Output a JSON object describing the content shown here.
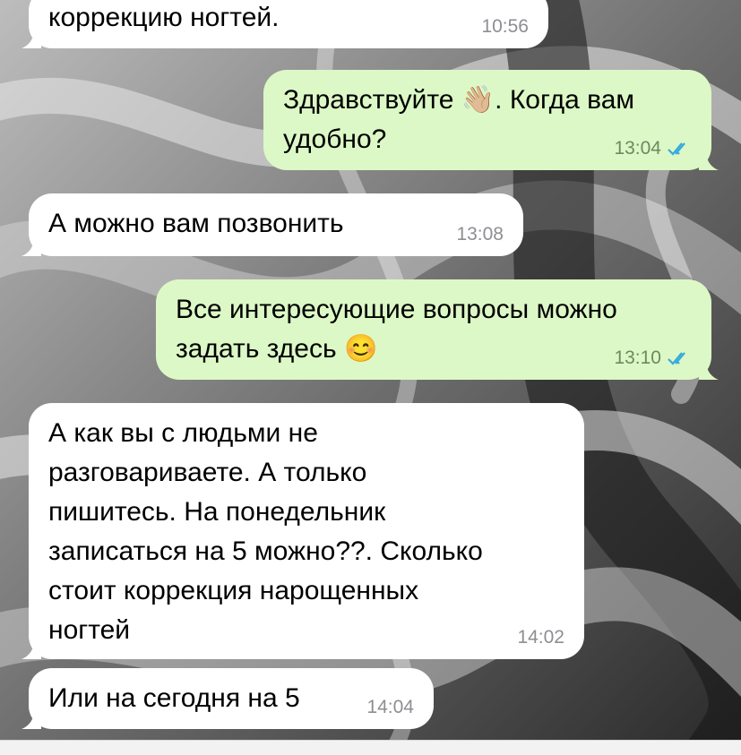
{
  "messages": [
    {
      "dir": "in",
      "text": "коррекцию ногтей.",
      "time": "10:56"
    },
    {
      "dir": "out",
      "text_a": "Здравствуйте ",
      "emoji": "👋🏼",
      "text_b": ". Когда вам\nудобно?",
      "time": "13:04",
      "status": "read"
    },
    {
      "dir": "in",
      "text": "А можно вам позвонить",
      "time": "13:08"
    },
    {
      "dir": "out",
      "text_a": "Все интересующие вопросы можно\nзадать здесь ",
      "emoji": "😊",
      "text_b": "",
      "time": "13:10",
      "status": "read"
    },
    {
      "dir": "in",
      "text": "А как вы с людьми не\nразговариваете. А только\nпишитесь. На понедельник\nзаписаться на 5 можно??. Сколько\nстоит коррекция нарощенных\nногтей",
      "time": "14:02"
    },
    {
      "dir": "in",
      "text": "Или на сегодня на 5",
      "time": "14:04"
    }
  ],
  "colors": {
    "incoming_bubble": "#ffffff",
    "outgoing_bubble": "#dcf8c6",
    "read_check": "#34aadc",
    "timestamp": "#8e8e93"
  },
  "icons": {
    "read_status": "double-check-icon"
  }
}
